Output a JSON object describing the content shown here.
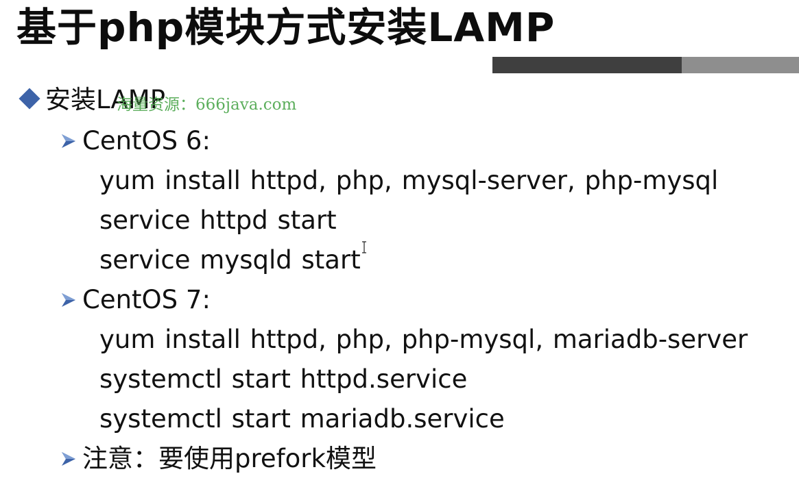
{
  "slide": {
    "title": "基于php模块方式安装LAMP",
    "bullet": "安装LAMP",
    "watermark": "海量资源：666java.com",
    "sections": [
      {
        "heading": "CentOS 6:",
        "lines": [
          "yum install httpd, php, mysql-server, php-mysql",
          "service httpd  start",
          "service  mysqld  start"
        ]
      },
      {
        "heading": "CentOS 7:",
        "lines": [
          "yum install httpd, php, php-mysql, mariadb-server",
          "systemctl  start  httpd.service",
          "systemctl  start  mariadb.service"
        ]
      }
    ],
    "note": "注意：要使用prefork模型"
  },
  "colors": {
    "diamond": "#3d63a8",
    "arrow": "#3d63a8",
    "watermark": "#4fa84f",
    "bar_dark": "#3f3f3f",
    "bar_light": "#8e8e8e"
  }
}
